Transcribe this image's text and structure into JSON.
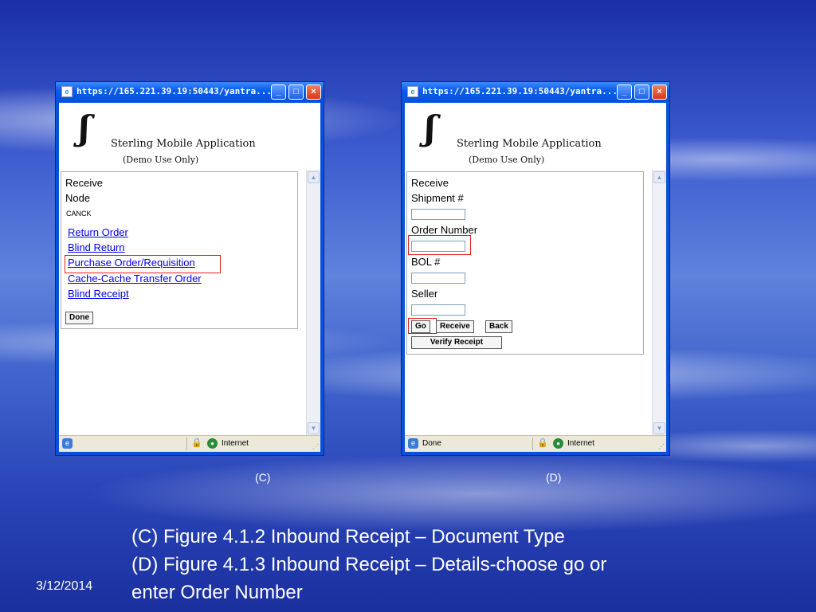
{
  "window_title": "https://165.221.39.19:50443/yantra...",
  "app": {
    "name": "Sterling Mobile Application",
    "subtitle": "(Demo Use Only)"
  },
  "window_c": {
    "header_line1": "Receive",
    "header_line2": "Node",
    "node_value": "CANCK",
    "links": [
      "Return Order",
      "Blind Return",
      "Purchase Order/Requisition",
      "Cache-Cache Transfer Order",
      "Blind Receipt"
    ],
    "done_button": "Done",
    "status": {
      "zone": "Internet"
    }
  },
  "window_d": {
    "header": "Receive",
    "labels": {
      "shipment": "Shipment #",
      "order": "Order Number",
      "bol": "BOL #",
      "seller": "Seller"
    },
    "fields": {
      "shipment": "",
      "order": "",
      "bol": "",
      "seller": ""
    },
    "buttons": {
      "go": "Go",
      "receive": "Receive",
      "back": "Back",
      "verify": "Verify Receipt"
    },
    "status": {
      "text": "Done",
      "zone": "Internet"
    }
  },
  "captions": {
    "c": "(C)",
    "d": "(D)"
  },
  "footer": {
    "line1": "(C) Figure 4.1.2 Inbound Receipt – Document Type",
    "line2": "(D) Figure 4.1.3 Inbound Receipt – Details-choose go or",
    "line3": "enter Order Number"
  },
  "date": "3/12/2014",
  "colors": {
    "highlight": "#e02020",
    "link": "#0000ee",
    "titlebar": "#0a5ee8"
  }
}
